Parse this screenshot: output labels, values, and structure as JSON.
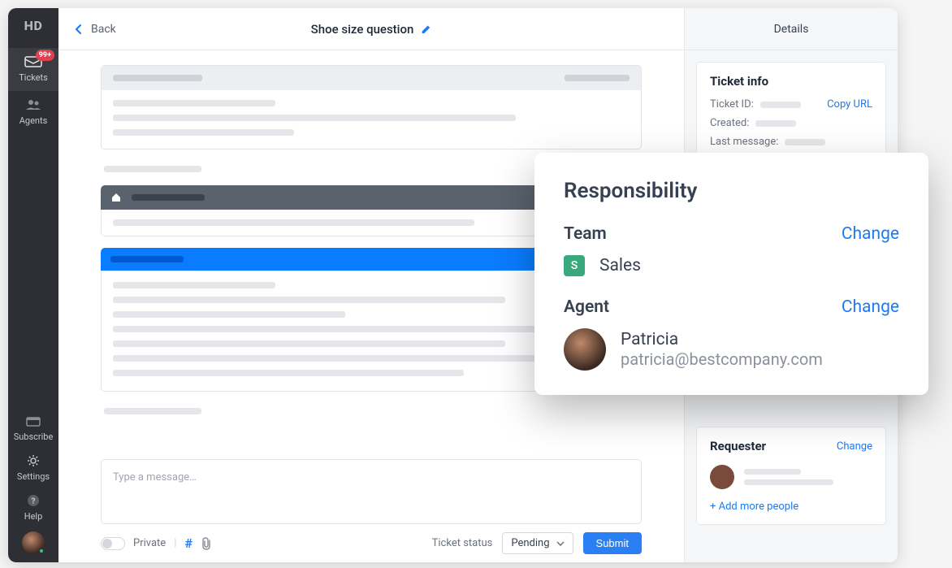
{
  "rail": {
    "logo": "HD",
    "items": [
      {
        "label": "Tickets",
        "badge": "99+"
      },
      {
        "label": "Agents"
      }
    ],
    "bottom": [
      {
        "label": "Subscribe"
      },
      {
        "label": "Settings"
      },
      {
        "label": "Help"
      }
    ]
  },
  "header": {
    "back": "Back",
    "title": "Shoe size question"
  },
  "composer": {
    "placeholder": "Type a message…",
    "private_label": "Private",
    "status_label": "Ticket status",
    "status_value": "Pending",
    "submit": "Submit"
  },
  "details": {
    "header": "Details",
    "ticket_info": {
      "title": "Ticket info",
      "id_label": "Ticket ID:",
      "copy_url": "Copy URL",
      "created_label": "Created:",
      "last_label": "Last message:"
    },
    "requester": {
      "title": "Requester",
      "change": "Change",
      "add": "+ Add more people"
    }
  },
  "overlay": {
    "title": "Responsibility",
    "team_label": "Team",
    "team_change": "Change",
    "team_name": "Sales",
    "team_initial": "S",
    "agent_label": "Agent",
    "agent_change": "Change",
    "agent_name": "Patricia",
    "agent_email": "patricia@bestcompany.com"
  }
}
